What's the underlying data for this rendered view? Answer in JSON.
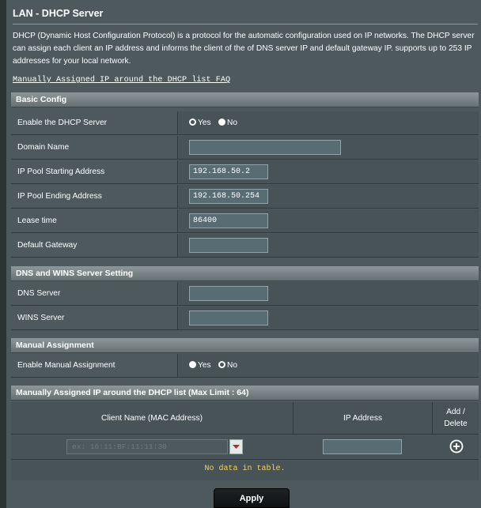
{
  "page": {
    "title": "LAN - DHCP Server",
    "description": "DHCP (Dynamic Host Configuration Protocol) is a protocol for the automatic configuration used on IP networks. The DHCP server can assign each client an IP address and informs the client of the of DNS server IP and default gateway IP. supports up to 253 IP addresses for your local network.",
    "faq_link": "Manually Assigned IP around the DHCP list FAQ"
  },
  "basic": {
    "header": "Basic Config",
    "enable_label": "Enable the DHCP Server",
    "yes": "Yes",
    "no": "No",
    "enable_value": "Yes",
    "domain_label": "Domain Name",
    "domain_value": "",
    "pool_start_label": "IP Pool Starting Address",
    "pool_start_value": "192.168.50.2",
    "pool_end_label": "IP Pool Ending Address",
    "pool_end_value": "192.168.50.254",
    "lease_label": "Lease time",
    "lease_value": "86400",
    "gateway_label": "Default Gateway",
    "gateway_value": ""
  },
  "dns": {
    "header": "DNS and WINS Server Setting",
    "dns_label": "DNS Server",
    "dns_value": "",
    "wins_label": "WINS Server",
    "wins_value": ""
  },
  "manual": {
    "header": "Manual Assignment",
    "enable_label": "Enable Manual Assignment",
    "yes": "Yes",
    "no": "No",
    "enable_value": "No"
  },
  "list": {
    "header": "Manually Assigned IP around the DHCP list (Max Limit : 64)",
    "col_client": "Client Name (MAC Address)",
    "col_ip": "IP Address",
    "col_add_line1": "Add /",
    "col_add_line2": "Delete",
    "mac_placeholder": "ex: 16:11:BF:11:11:30",
    "ip_value": "",
    "empty_text": "No data in table."
  },
  "apply_label": "Apply"
}
